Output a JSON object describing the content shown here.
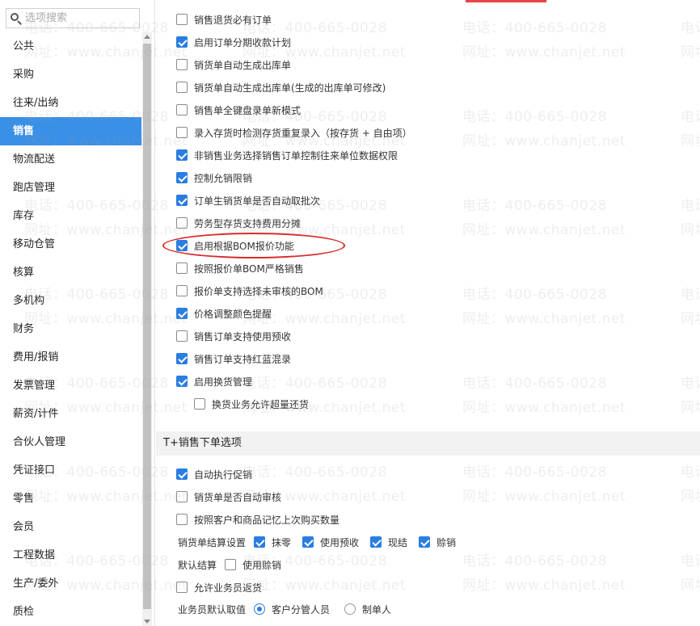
{
  "sidebar": {
    "search_placeholder": "选项搜索",
    "items": [
      {
        "label": "公共",
        "active": false
      },
      {
        "label": "采购",
        "active": false
      },
      {
        "label": "往来/出纳",
        "active": false
      },
      {
        "label": "销售",
        "active": true
      },
      {
        "label": "物流配送",
        "active": false
      },
      {
        "label": "跑店管理",
        "active": false
      },
      {
        "label": "库存",
        "active": false
      },
      {
        "label": "移动仓管",
        "active": false
      },
      {
        "label": "核算",
        "active": false
      },
      {
        "label": "多机构",
        "active": false
      },
      {
        "label": "财务",
        "active": false
      },
      {
        "label": "费用/报销",
        "active": false
      },
      {
        "label": "发票管理",
        "active": false
      },
      {
        "label": "薪资/计件",
        "active": false
      },
      {
        "label": "合伙人管理",
        "active": false
      },
      {
        "label": "凭证接口",
        "active": false
      },
      {
        "label": "零售",
        "active": false
      },
      {
        "label": "会员",
        "active": false
      },
      {
        "label": "工程数据",
        "active": false
      },
      {
        "label": "生产/委外",
        "active": false
      },
      {
        "label": "质检",
        "active": false
      }
    ]
  },
  "options": [
    {
      "label": "销售退货必有订单",
      "checked": false
    },
    {
      "label": "启用订单分期收款计划",
      "checked": true
    },
    {
      "label": "销货单自动生成出库单",
      "checked": false
    },
    {
      "label": "销货单自动生成出库单(生成的出库单可修改)",
      "checked": false
    },
    {
      "label": "销售单全键盘录单新模式",
      "checked": false
    },
    {
      "label": "录入存货时检测存货重复录入（按存货 + 自由项）",
      "checked": false
    },
    {
      "label": "非销售业务选择销售订单控制往来单位数据权限",
      "checked": true
    },
    {
      "label": "控制允销限销",
      "checked": true
    },
    {
      "label": "订单生销货单是否自动取批次",
      "checked": true
    },
    {
      "label": "劳务型存货支持费用分摊",
      "checked": false
    },
    {
      "label": "启用根据BOM报价功能",
      "checked": true
    },
    {
      "label": "按照报价单BOM严格销售",
      "checked": false
    },
    {
      "label": "报价单支持选择未审核的BOM",
      "checked": false
    },
    {
      "label": "价格调整颜色提醒",
      "checked": true
    },
    {
      "label": "销售订单支持使用预收",
      "checked": false
    },
    {
      "label": "销售订单支持红蓝混录",
      "checked": true
    },
    {
      "label": "启用换货管理",
      "checked": true
    },
    {
      "label": "换货业务允许超量还货",
      "checked": false
    }
  ],
  "section": {
    "title": "T+销售下单选项",
    "options": [
      {
        "label": "自动执行促销",
        "checked": true
      },
      {
        "label": "销货单是否自动审核",
        "checked": false
      },
      {
        "label": "按照客户和商品记忆上次购买数量",
        "checked": false
      }
    ],
    "settlement": {
      "label": "销货单结算设置",
      "items": [
        {
          "label": "抹零",
          "checked": true
        },
        {
          "label": "使用预收",
          "checked": true
        },
        {
          "label": "现结",
          "checked": true
        },
        {
          "label": "赊销",
          "checked": true
        }
      ]
    },
    "default_settle": {
      "label": "默认结算",
      "item": {
        "label": "使用赊销",
        "checked": false
      }
    },
    "allow_return": {
      "label": "允许业务员返货",
      "checked": false
    },
    "salesman_default": {
      "label": "业务员默认取值",
      "options": [
        {
          "label": "客户分管人员",
          "selected": true
        },
        {
          "label": "制单人",
          "selected": false
        }
      ]
    }
  },
  "watermark": {
    "phone": "电话：400-665-0028",
    "site": "网址：www.chanjet.net"
  },
  "colors": {
    "accent": "#3a8fe6",
    "checkbox": "#2a7de1",
    "highlight": "#d92b2b"
  }
}
